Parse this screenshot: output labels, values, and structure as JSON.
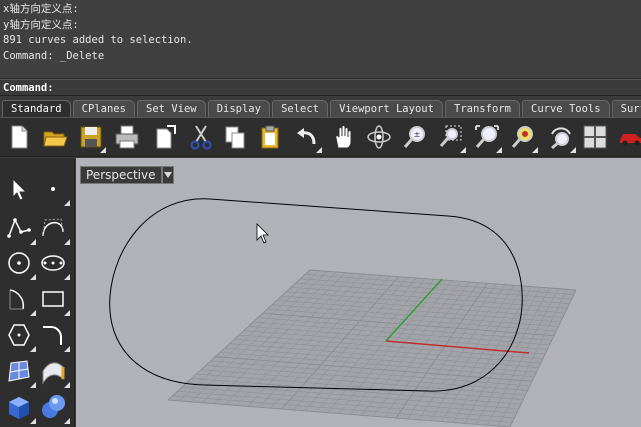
{
  "history": {
    "lines": [
      "x轴方向定义点:",
      "y轴方向定义点:",
      "891 curves added to selection.",
      "Command: _Delete"
    ]
  },
  "command": {
    "prompt": "Command:"
  },
  "tabs": [
    {
      "label": "Standard",
      "active": true
    },
    {
      "label": "CPlanes"
    },
    {
      "label": "Set View"
    },
    {
      "label": "Display"
    },
    {
      "label": "Select"
    },
    {
      "label": "Viewport Layout"
    },
    {
      "label": "Transform"
    },
    {
      "label": "Curve Tools"
    },
    {
      "label": "Surface"
    }
  ],
  "viewport": {
    "title": "Perspective"
  },
  "colors": {
    "background": "#b0b2b8",
    "grid": "#8a8c92",
    "x_axis": "#c03030",
    "y_axis": "#30a030",
    "curve": "#000000"
  },
  "toolbar_icons": [
    "new-icon",
    "open-icon",
    "save-icon",
    "print-icon",
    "export-icon",
    "cut-icon",
    "copy-icon",
    "paste-icon",
    "undo-icon",
    "pan-icon",
    "rotate-view-icon",
    "zoom-dynamic-icon",
    "zoom-window-icon",
    "zoom-extents-icon",
    "zoom-selected-icon",
    "rotate-camera-icon",
    "viewport-layout-icon",
    "car-icon"
  ],
  "left_icons": [
    "select-arrow-icon",
    "point-icon",
    "polyline-icon",
    "curve-icon",
    "circle-icon",
    "ellipse-icon",
    "arc-icon",
    "rectangle-icon",
    "polygon-icon",
    "fillet-icon",
    "surface-icon",
    "extrude-surface-icon",
    "box-icon",
    "sphere-icon"
  ]
}
